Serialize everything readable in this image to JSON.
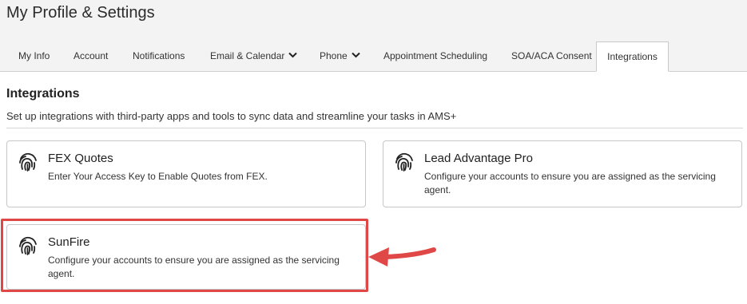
{
  "page": {
    "title": "My Profile & Settings"
  },
  "tabs": [
    {
      "label": "My Info"
    },
    {
      "label": "Account"
    },
    {
      "label": "Notifications"
    },
    {
      "label": "Email & Calendar",
      "dropdown": true
    },
    {
      "label": "Phone",
      "dropdown": true
    },
    {
      "label": "Appointment Scheduling"
    },
    {
      "label": "SOA/ACA Consent"
    },
    {
      "label": "Integrations",
      "active": true
    }
  ],
  "integrations": {
    "title": "Integrations",
    "description": "Set up integrations with third-party apps and tools to sync data and streamline your tasks in AMS+",
    "cards": [
      {
        "title": "FEX Quotes",
        "description": "Enter Your Access Key to Enable Quotes from FEX.",
        "icon": "fingerprint-icon"
      },
      {
        "title": "Lead Advantage Pro",
        "description_line1": "Configure your accounts to ensure you are assigned as the servicing",
        "description_line2": "agent.",
        "icon": "fingerprint-icon"
      },
      {
        "title": "SunFire",
        "description_line1": "Configure your accounts to ensure you are assigned as the servicing",
        "description_line2": "agent.",
        "icon": "fingerprint-icon"
      }
    ]
  },
  "annotation": {
    "highlight_color": "#e04848",
    "arrow_color": "#e04848"
  }
}
